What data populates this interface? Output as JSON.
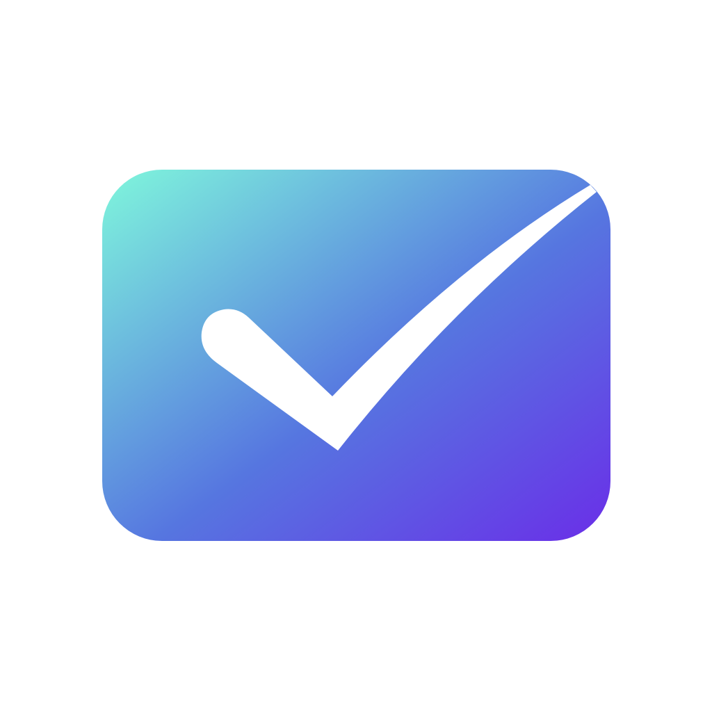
{
  "icon": {
    "name": "checkmark-badge-icon",
    "shape": "rounded-rectangle",
    "symbol": "checkmark"
  },
  "colors": {
    "background": "#ffffff",
    "gradient_start": "#7ff7dc",
    "gradient_mid": "#5676e0",
    "gradient_end": "#6a2ee8",
    "checkmark": "#ffffff"
  }
}
